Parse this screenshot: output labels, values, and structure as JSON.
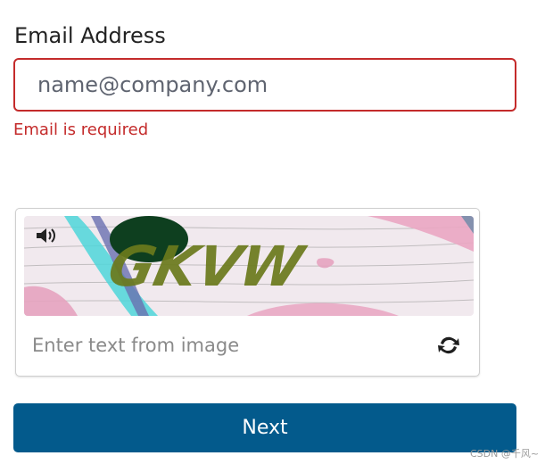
{
  "email": {
    "label": "Email Address",
    "placeholder": "name@company.com",
    "value": "",
    "error": "Email is required"
  },
  "captcha": {
    "image_text": "GKVW",
    "audio_icon": "speaker-icon",
    "refresh_icon": "refresh-icon",
    "input_placeholder": "Enter text from image",
    "input_value": ""
  },
  "next_button": {
    "label": "Next"
  },
  "watermark": "CSDN @千风~",
  "colors": {
    "error": "#c42b2b",
    "primary": "#035a8c",
    "captcha_text": "#6b7a1c"
  }
}
